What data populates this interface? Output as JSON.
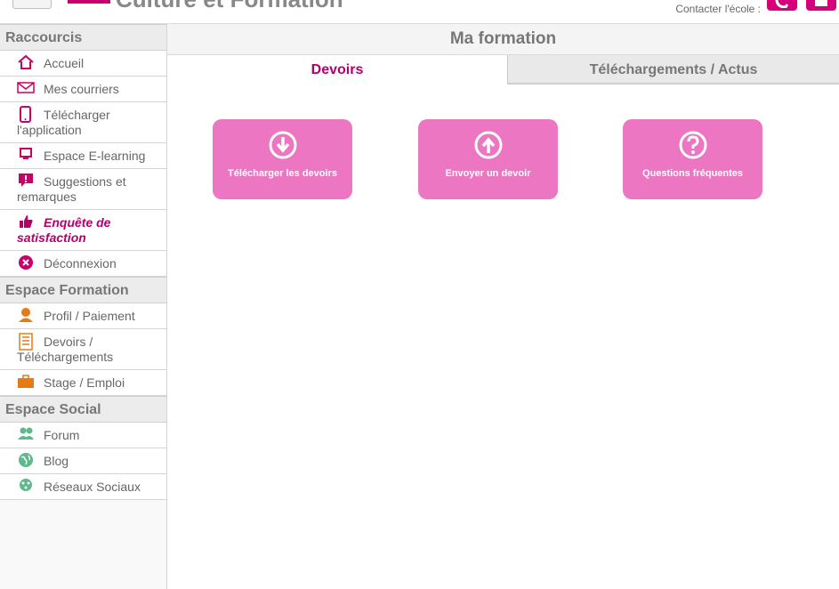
{
  "header": {
    "brand": "Culture et Formation",
    "contact_label": "Contacter l'école :"
  },
  "colors": {
    "accent": "#c8006d",
    "card": "#ec76c2",
    "icon_orange": "#e57b14",
    "icon_green": "#5fb98c"
  },
  "sidebar": {
    "sections": [
      {
        "title": "Raccourcis"
      },
      {
        "title": "Espace Formation"
      },
      {
        "title": "Espace Social"
      }
    ],
    "raccourcis": [
      {
        "label": "Accueil",
        "icon": "home-icon"
      },
      {
        "label": "Mes courriers",
        "icon": "envelope-icon"
      },
      {
        "label": "Télécharger l'application",
        "icon": "mobile-icon"
      },
      {
        "label": "Espace E-learning",
        "icon": "monitor-icon"
      },
      {
        "label": "Suggestions et remarques",
        "icon": "comment-alert-icon"
      },
      {
        "label": "Enquête de satisfaction",
        "icon": "thumbs-up-icon"
      },
      {
        "label": "Déconnexion",
        "icon": "close-circle-icon"
      }
    ],
    "formation": [
      {
        "label": "Profil / Paiement",
        "icon": "user-icon"
      },
      {
        "label": "Devoirs / Téléchargements",
        "icon": "list-document-icon"
      },
      {
        "label": "Stage / Emploi",
        "icon": "briefcase-icon"
      }
    ],
    "social": [
      {
        "label": "Forum",
        "icon": "users-icon"
      },
      {
        "label": "Blog",
        "icon": "globe-icon"
      },
      {
        "label": "Réseaux Sociaux",
        "icon": "network-icon"
      }
    ]
  },
  "main": {
    "title": "Ma formation",
    "tabs": [
      {
        "label": "Devoirs"
      },
      {
        "label": "Téléchargements / Actus"
      }
    ],
    "cards": [
      {
        "label": "Télécharger les devoirs",
        "icon": "download-circle-icon"
      },
      {
        "label": "Envoyer un devoir",
        "icon": "upload-circle-icon"
      },
      {
        "label": "Questions fréquentes",
        "icon": "question-circle-icon"
      }
    ]
  }
}
